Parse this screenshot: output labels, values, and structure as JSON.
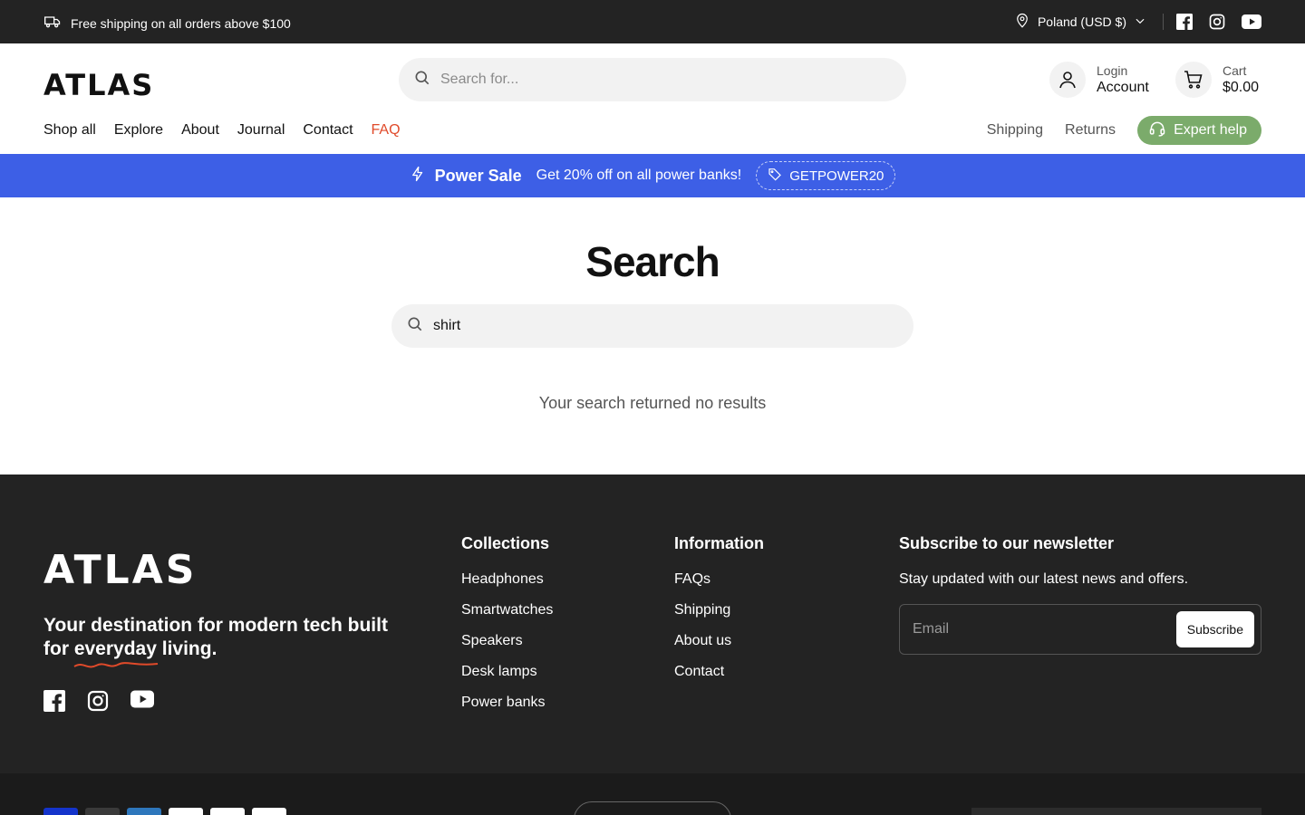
{
  "topbar": {
    "shipping_text": "Free shipping on all orders above $100",
    "country": "Poland (USD $)",
    "social": [
      "facebook-icon",
      "instagram-icon",
      "youtube-icon"
    ]
  },
  "header": {
    "logo": "ATLAS",
    "search_placeholder": "Search for...",
    "account_small": "Login",
    "account_big": "Account",
    "cart_small": "Cart",
    "cart_big": "$0.00"
  },
  "nav": {
    "items": [
      "Shop all",
      "Explore",
      "About",
      "Journal",
      "Contact",
      "FAQ"
    ],
    "secondary": [
      "Shipping",
      "Returns"
    ],
    "expert": "Expert help"
  },
  "promo": {
    "title": "Power Sale",
    "message": "Get 20% off on all power banks!",
    "code": "GETPOWER20"
  },
  "main": {
    "title": "Search",
    "query": "shirt",
    "no_results": "Your search returned no results"
  },
  "footer": {
    "logo": "ATLAS",
    "tagline_pre": "Your destination for modern tech built for ",
    "tagline_em": "everyday",
    "tagline_post": " living.",
    "collections_title": "Collections",
    "collections": [
      "Headphones",
      "Smartwatches",
      "Speakers",
      "Desk lamps",
      "Power banks"
    ],
    "information_title": "Information",
    "information": [
      "FAQs",
      "Shipping",
      "About us",
      "Contact"
    ],
    "newsletter_title": "Subscribe to our newsletter",
    "newsletter_text": "Stay updated with our latest news and offers.",
    "email_placeholder": "Email",
    "subscribe": "Subscribe"
  },
  "colors": {
    "dark": "#232323",
    "promo_blue": "#3d5fe6",
    "expert_green": "#7bab6b",
    "faq_red": "#e04a2a"
  }
}
